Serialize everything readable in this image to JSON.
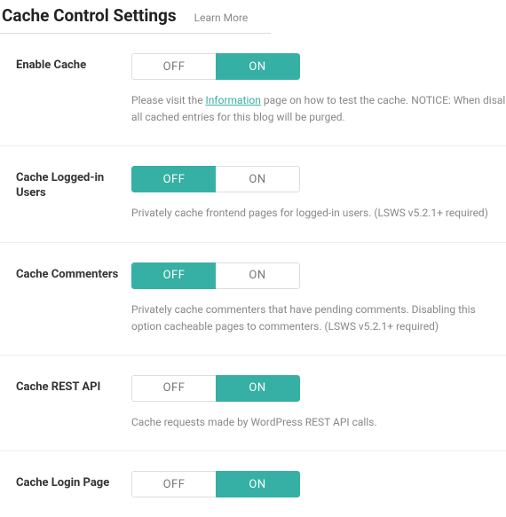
{
  "header": {
    "title": "Cache Control Settings",
    "learn_more": "Learn More"
  },
  "toggle": {
    "off": "OFF",
    "on": "ON"
  },
  "rows": {
    "enable_cache": {
      "label": "Enable Cache",
      "state": "on",
      "desc_pre": "Please visit the ",
      "info_link": "Information",
      "desc_mid": " page on how to test the cache. ",
      "notice_label": "NOTICE:",
      "desc_post": " When disal all cached entries for this blog will be purged."
    },
    "logged_in": {
      "label": "Cache Logged-in Users",
      "state": "off",
      "desc": "Privately cache frontend pages for logged-in users. (LSWS v5.2.1+ required)"
    },
    "commenters": {
      "label": "Cache Commenters",
      "state": "off",
      "desc": "Privately cache commenters that have pending comments. Disabling this option cacheable pages to commenters. (LSWS v5.2.1+ required)"
    },
    "rest": {
      "label": "Cache REST API",
      "state": "on",
      "desc": "Cache requests made by WordPress REST API calls."
    },
    "login": {
      "label": "Cache Login Page",
      "state": "on",
      "desc": ""
    }
  }
}
